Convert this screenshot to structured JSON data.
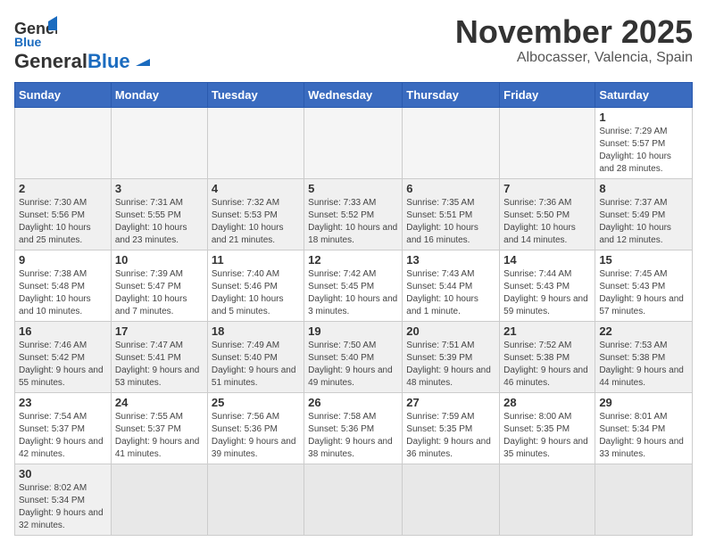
{
  "header": {
    "logo_text_general": "General",
    "logo_text_blue": "Blue",
    "month": "November 2025",
    "location": "Albocasser, Valencia, Spain"
  },
  "weekdays": [
    "Sunday",
    "Monday",
    "Tuesday",
    "Wednesday",
    "Thursday",
    "Friday",
    "Saturday"
  ],
  "weeks": [
    [
      {
        "day": "",
        "info": ""
      },
      {
        "day": "",
        "info": ""
      },
      {
        "day": "",
        "info": ""
      },
      {
        "day": "",
        "info": ""
      },
      {
        "day": "",
        "info": ""
      },
      {
        "day": "",
        "info": ""
      },
      {
        "day": "1",
        "info": "Sunrise: 7:29 AM\nSunset: 5:57 PM\nDaylight: 10 hours and 28 minutes."
      }
    ],
    [
      {
        "day": "2",
        "info": "Sunrise: 7:30 AM\nSunset: 5:56 PM\nDaylight: 10 hours and 25 minutes."
      },
      {
        "day": "3",
        "info": "Sunrise: 7:31 AM\nSunset: 5:55 PM\nDaylight: 10 hours and 23 minutes."
      },
      {
        "day": "4",
        "info": "Sunrise: 7:32 AM\nSunset: 5:53 PM\nDaylight: 10 hours and 21 minutes."
      },
      {
        "day": "5",
        "info": "Sunrise: 7:33 AM\nSunset: 5:52 PM\nDaylight: 10 hours and 18 minutes."
      },
      {
        "day": "6",
        "info": "Sunrise: 7:35 AM\nSunset: 5:51 PM\nDaylight: 10 hours and 16 minutes."
      },
      {
        "day": "7",
        "info": "Sunrise: 7:36 AM\nSunset: 5:50 PM\nDaylight: 10 hours and 14 minutes."
      },
      {
        "day": "8",
        "info": "Sunrise: 7:37 AM\nSunset: 5:49 PM\nDaylight: 10 hours and 12 minutes."
      }
    ],
    [
      {
        "day": "9",
        "info": "Sunrise: 7:38 AM\nSunset: 5:48 PM\nDaylight: 10 hours and 10 minutes."
      },
      {
        "day": "10",
        "info": "Sunrise: 7:39 AM\nSunset: 5:47 PM\nDaylight: 10 hours and 7 minutes."
      },
      {
        "day": "11",
        "info": "Sunrise: 7:40 AM\nSunset: 5:46 PM\nDaylight: 10 hours and 5 minutes."
      },
      {
        "day": "12",
        "info": "Sunrise: 7:42 AM\nSunset: 5:45 PM\nDaylight: 10 hours and 3 minutes."
      },
      {
        "day": "13",
        "info": "Sunrise: 7:43 AM\nSunset: 5:44 PM\nDaylight: 10 hours and 1 minute."
      },
      {
        "day": "14",
        "info": "Sunrise: 7:44 AM\nSunset: 5:43 PM\nDaylight: 9 hours and 59 minutes."
      },
      {
        "day": "15",
        "info": "Sunrise: 7:45 AM\nSunset: 5:43 PM\nDaylight: 9 hours and 57 minutes."
      }
    ],
    [
      {
        "day": "16",
        "info": "Sunrise: 7:46 AM\nSunset: 5:42 PM\nDaylight: 9 hours and 55 minutes."
      },
      {
        "day": "17",
        "info": "Sunrise: 7:47 AM\nSunset: 5:41 PM\nDaylight: 9 hours and 53 minutes."
      },
      {
        "day": "18",
        "info": "Sunrise: 7:49 AM\nSunset: 5:40 PM\nDaylight: 9 hours and 51 minutes."
      },
      {
        "day": "19",
        "info": "Sunrise: 7:50 AM\nSunset: 5:40 PM\nDaylight: 9 hours and 49 minutes."
      },
      {
        "day": "20",
        "info": "Sunrise: 7:51 AM\nSunset: 5:39 PM\nDaylight: 9 hours and 48 minutes."
      },
      {
        "day": "21",
        "info": "Sunrise: 7:52 AM\nSunset: 5:38 PM\nDaylight: 9 hours and 46 minutes."
      },
      {
        "day": "22",
        "info": "Sunrise: 7:53 AM\nSunset: 5:38 PM\nDaylight: 9 hours and 44 minutes."
      }
    ],
    [
      {
        "day": "23",
        "info": "Sunrise: 7:54 AM\nSunset: 5:37 PM\nDaylight: 9 hours and 42 minutes."
      },
      {
        "day": "24",
        "info": "Sunrise: 7:55 AM\nSunset: 5:37 PM\nDaylight: 9 hours and 41 minutes."
      },
      {
        "day": "25",
        "info": "Sunrise: 7:56 AM\nSunset: 5:36 PM\nDaylight: 9 hours and 39 minutes."
      },
      {
        "day": "26",
        "info": "Sunrise: 7:58 AM\nSunset: 5:36 PM\nDaylight: 9 hours and 38 minutes."
      },
      {
        "day": "27",
        "info": "Sunrise: 7:59 AM\nSunset: 5:35 PM\nDaylight: 9 hours and 36 minutes."
      },
      {
        "day": "28",
        "info": "Sunrise: 8:00 AM\nSunset: 5:35 PM\nDaylight: 9 hours and 35 minutes."
      },
      {
        "day": "29",
        "info": "Sunrise: 8:01 AM\nSunset: 5:34 PM\nDaylight: 9 hours and 33 minutes."
      }
    ],
    [
      {
        "day": "30",
        "info": "Sunrise: 8:02 AM\nSunset: 5:34 PM\nDaylight: 9 hours and 32 minutes."
      },
      {
        "day": "",
        "info": ""
      },
      {
        "day": "",
        "info": ""
      },
      {
        "day": "",
        "info": ""
      },
      {
        "day": "",
        "info": ""
      },
      {
        "day": "",
        "info": ""
      },
      {
        "day": "",
        "info": ""
      }
    ]
  ]
}
